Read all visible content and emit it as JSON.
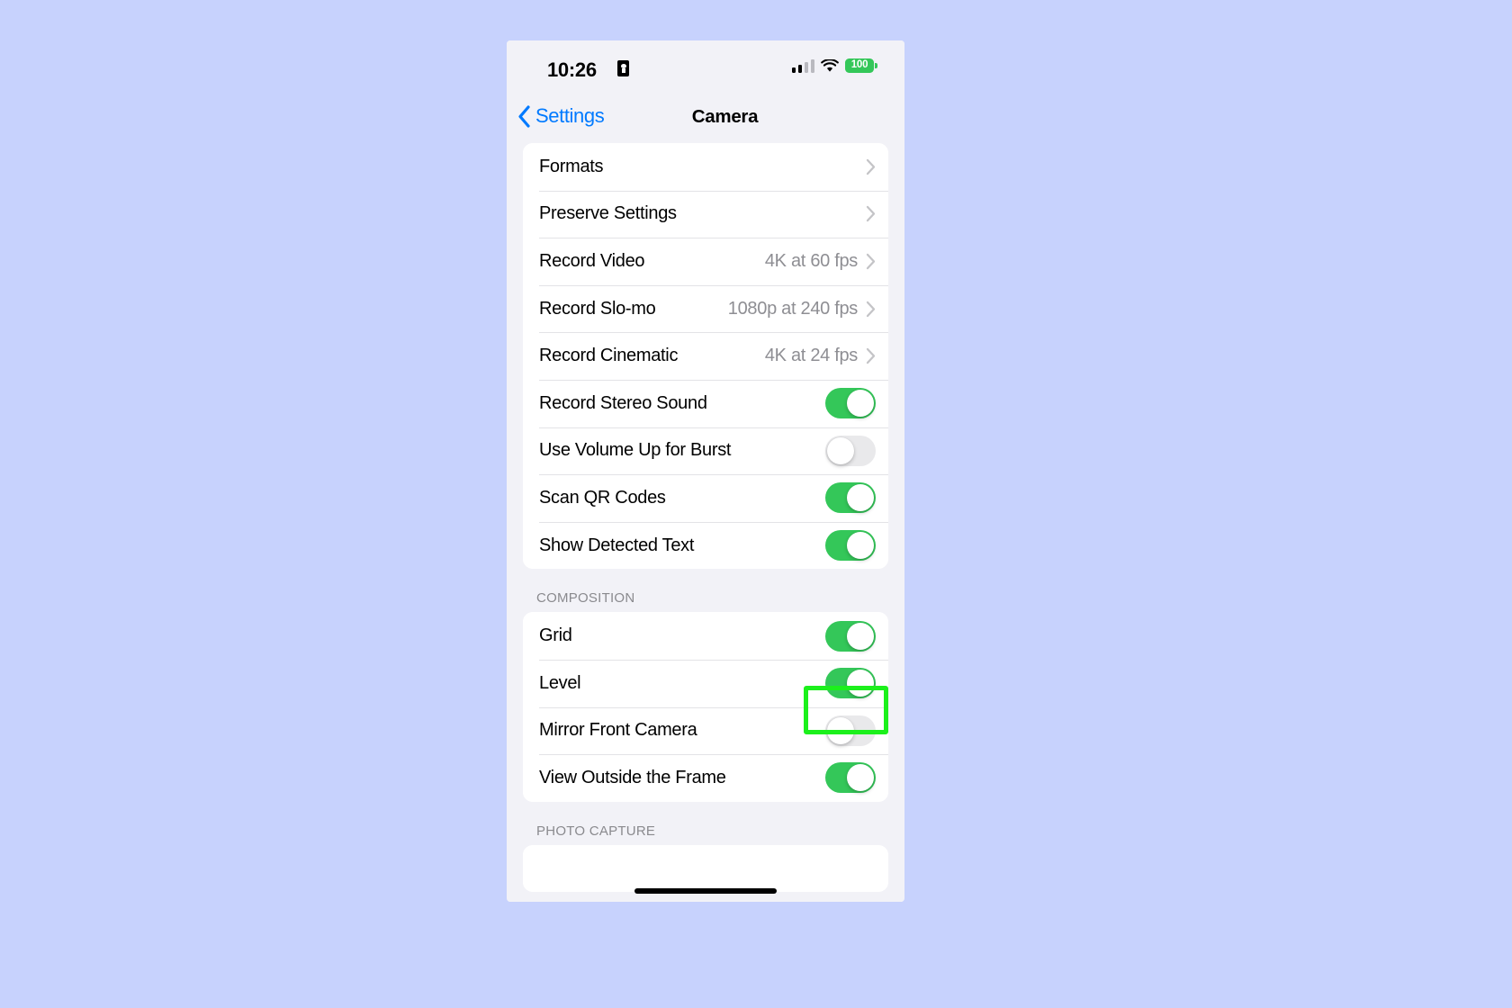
{
  "status_bar": {
    "time": "10:26",
    "lock_icon": "lock-portrait-orientation-icon",
    "cellular_icon": "cellular-signal-icon",
    "wifi_icon": "wifi-icon",
    "battery_icon": "battery-icon",
    "battery_level": "100"
  },
  "nav": {
    "back_label": "Settings",
    "back_icon": "chevron-left-icon",
    "title": "Camera"
  },
  "colors": {
    "page_background": "#c7d2fd",
    "screen_background": "#f2f2f7",
    "card_background": "#ffffff",
    "accent_blue": "#007aff",
    "toggle_on_green": "#34c759",
    "toggle_off_gray": "#e9e9eb",
    "secondary_text": "#8e8e93",
    "highlight_green": "#1cf01c"
  },
  "sections": [
    {
      "header": "",
      "rows": [
        {
          "label": "Formats",
          "type": "disclosure",
          "value": "",
          "icon": "chevron-right-icon"
        },
        {
          "label": "Preserve Settings",
          "type": "disclosure",
          "value": "",
          "icon": "chevron-right-icon"
        },
        {
          "label": "Record Video",
          "type": "disclosure",
          "value": "4K at 60 fps",
          "icon": "chevron-right-icon"
        },
        {
          "label": "Record Slo-mo",
          "type": "disclosure",
          "value": "1080p at 240 fps",
          "icon": "chevron-right-icon"
        },
        {
          "label": "Record Cinematic",
          "type": "disclosure",
          "value": "4K at 24 fps",
          "icon": "chevron-right-icon"
        },
        {
          "label": "Record Stereo Sound",
          "type": "toggle",
          "state": "on"
        },
        {
          "label": "Use Volume Up for Burst",
          "type": "toggle",
          "state": "off"
        },
        {
          "label": "Scan QR Codes",
          "type": "toggle",
          "state": "on"
        },
        {
          "label": "Show Detected Text",
          "type": "toggle",
          "state": "on"
        }
      ]
    },
    {
      "header": "COMPOSITION",
      "rows": [
        {
          "label": "Grid",
          "type": "toggle",
          "state": "on"
        },
        {
          "label": "Level",
          "type": "toggle",
          "state": "on",
          "highlighted": true
        },
        {
          "label": "Mirror Front Camera",
          "type": "toggle",
          "state": "off"
        },
        {
          "label": "View Outside the Frame",
          "type": "toggle",
          "state": "on"
        }
      ]
    },
    {
      "header": "PHOTO CAPTURE",
      "rows": []
    }
  ],
  "annotation": {
    "target": "level-toggle",
    "shape": "rectangle-outline"
  },
  "home_indicator": "home-indicator"
}
